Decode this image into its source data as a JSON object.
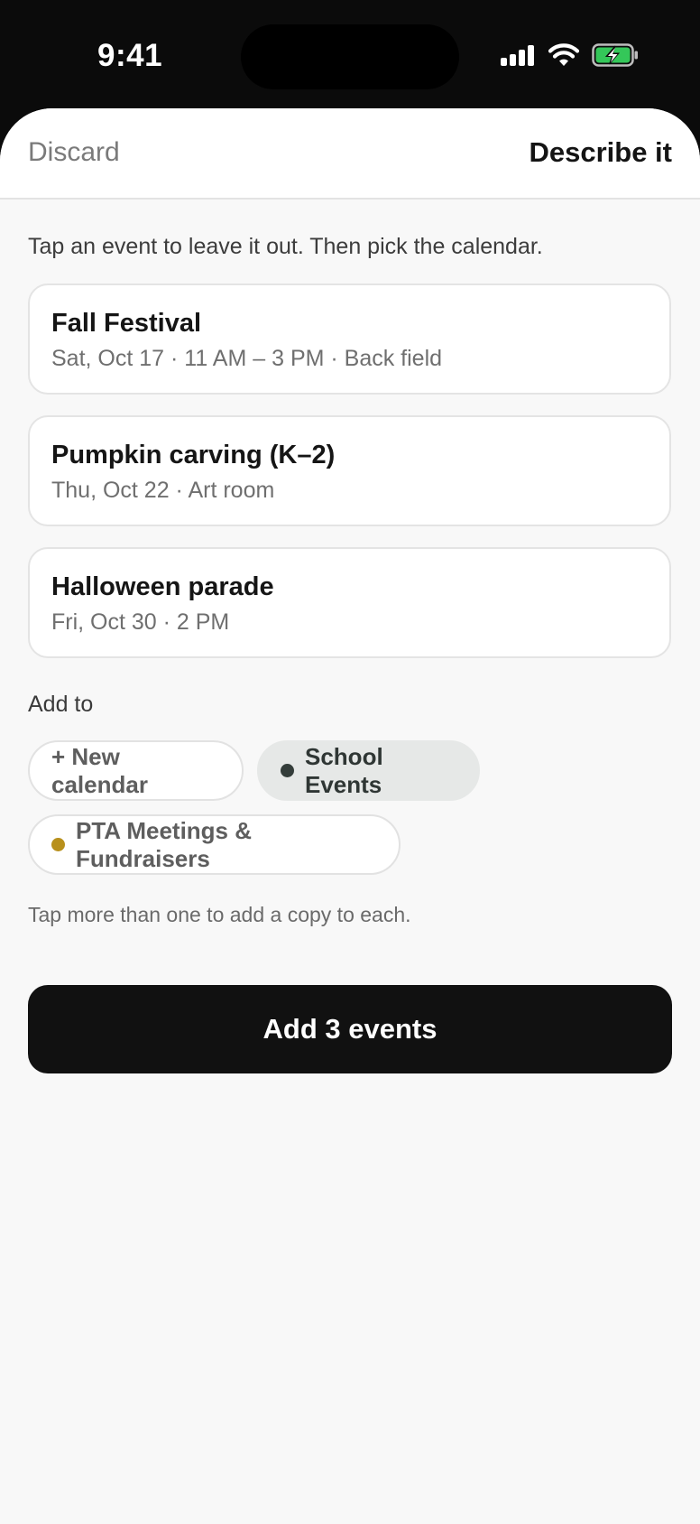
{
  "status_bar": {
    "time": "9:41"
  },
  "header": {
    "discard_label": "Discard",
    "describe_label": "Describe it"
  },
  "instruction": "Tap an event to leave it out. Then pick the calendar.",
  "events": [
    {
      "title": "Fall Festival",
      "detail": "Sat, Oct 17 · 11 AM – 3 PM · Back field"
    },
    {
      "title": "Pumpkin carving (K–2)",
      "detail": "Thu, Oct 22 · Art room"
    },
    {
      "title": "Halloween parade",
      "detail": "Fri, Oct 30 · 2 PM"
    }
  ],
  "add_to": {
    "label": "Add to",
    "chips": [
      {
        "label": "+ New calendar",
        "selected": false
      },
      {
        "label": "School Events",
        "selected": true,
        "dot_color": "#343d3a"
      },
      {
        "label": "PTA Meetings & Fundraisers",
        "selected": false,
        "dot_color": "#b8901c"
      }
    ],
    "hint": "Tap more than one to add a copy to each."
  },
  "primary_action": {
    "label": "Add 3 events"
  },
  "colors": {
    "battery_fill": "#34c759",
    "primary_button": "#111111",
    "selected_chip_bg": "#e6e8e7"
  }
}
